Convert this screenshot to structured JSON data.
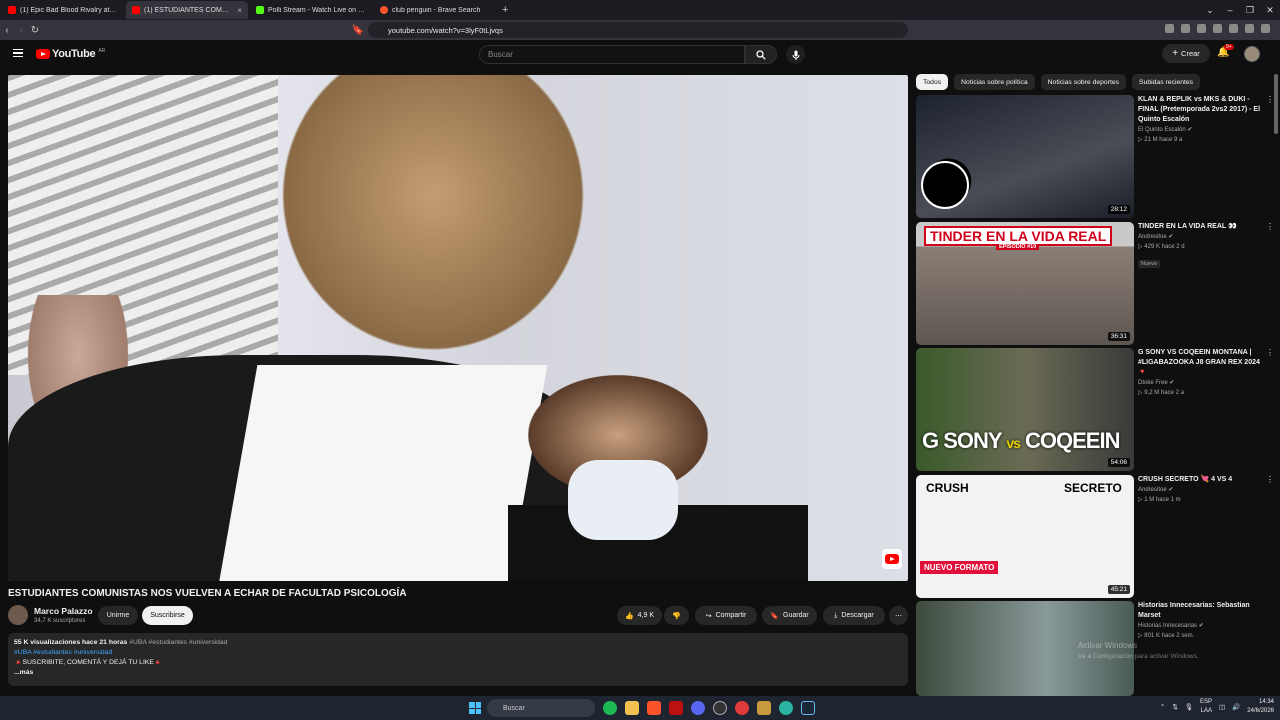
{
  "browser": {
    "tabs": [
      {
        "title": "(1) Epic Bad Blood Rivalry at Power S",
        "icon_color": "#ff0000",
        "active": false
      },
      {
        "title": "(1) ESTUDIANTES COMUNISTAS",
        "icon_color": "#ff0000",
        "active": true
      },
      {
        "title": "Polli Stream - Watch Live on Kick",
        "icon_color": "#53fc18",
        "active": false
      },
      {
        "title": "club penguin - Brave Search",
        "icon_color": "#fb542b",
        "active": false
      }
    ],
    "close_glyph": "×",
    "new_tab_glyph": "+",
    "url": "youtube.com/watch?v=3lyF0tLjvqs"
  },
  "youtube": {
    "logo_text": "YouTube",
    "country_code": "AR",
    "search_placeholder": "Buscar",
    "create_label": "Crear",
    "notif_count": "9+"
  },
  "video": {
    "title": "ESTUDIANTES COMUNISTAS NOS VUELVEN A ECHAR DE FACULTAD PSICOLOGÍA",
    "channel": "Marco Palazzo",
    "subscribers": "34,7 K suscriptores",
    "join_label": "Unirme",
    "subscribe_label": "Suscribirse",
    "likes": "4,9 K",
    "share_label": "Compartir",
    "save_label": "Guardar",
    "download_label": "Descargar",
    "views_line": "55 K visualizaciones  hace 21 horas",
    "header_tags": "#UBA #estudiantes #universidad",
    "hashtags": "#UBA #estudiantes #universidad",
    "desc_line": "🔺SUSCRIBITE, COMENTÁ Y DEJÁ TU LIKE🔺",
    "more_label": "...más"
  },
  "chips": [
    "Todos",
    "Noticias sobre política",
    "Noticias sobre deportes",
    "Subidas recientes"
  ],
  "recommendations": [
    {
      "title": "KLAN & REPLIK vs MKS & DUKI - FINAL (Pretemporada 2vs2 2017) - El Quinto Escalón",
      "channel": "El Quinto Escalón ✔",
      "meta": "▷ 21 M  hace 9 a",
      "duration": "28:12",
      "badge": "",
      "thumb_color": "#2a2f3a"
    },
    {
      "title": "TINDER EN LA VIDA REAL 👀",
      "channel": "Andresitoe ✔",
      "meta": "▷ 429 K  hace 2 d",
      "duration": "36:31",
      "badge": "Nuevo",
      "thumb_color": "#7a6f66"
    },
    {
      "title": "G SONY VS COQEEIN MONTANA | #LIGABAZOOKA J8 GRAN REX 2024 🔻",
      "channel": "Dtoke Free ✔",
      "meta": "▷ 9,2 M  hace 2 a",
      "duration": "54:06",
      "badge": "",
      "thumb_color": "#3b3f2e"
    },
    {
      "title": "CRUSH SECRETO 💘 4 VS 4",
      "channel": "Andresitoe ✔",
      "meta": "▷ 1 M  hace 1 m",
      "duration": "45:21",
      "badge": "",
      "thumb_color": "#e9e9e9"
    },
    {
      "title": "Historias Innecesarias: Sebastian Marset",
      "channel": "Historias Innecesarias ✔",
      "meta": "▷ 801 K  hace 2 sem.",
      "duration": "",
      "badge": "",
      "thumb_color": "#5a6a6a"
    }
  ],
  "thumb_text": {
    "tinder": "TINDER EN LA VIDA REAL",
    "tinder_ep": "EPISODIO #10",
    "sony_left": "G SONY",
    "sony_vs": "vs",
    "sony_right": "COQEEIN",
    "crush_left": "CRUSH",
    "crush_right": "SECRETO",
    "crush_banner": "NUEVO FORMATO"
  },
  "watermark": {
    "line1": "Activar Windows",
    "line2": "Ve a Configuración para activar Windows."
  },
  "taskbar": {
    "search_placeholder": "Buscar",
    "lang": "ESP",
    "lang2": "LAA",
    "time": "14:34",
    "date": "24/6/2026"
  }
}
